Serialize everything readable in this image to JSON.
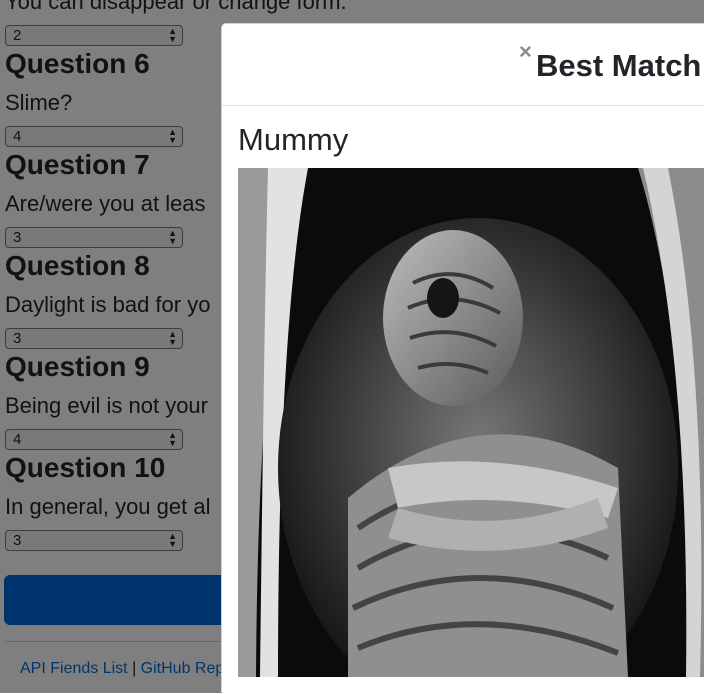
{
  "questions": {
    "q5": {
      "text": "You can disappear or change form.",
      "value": "2"
    },
    "q6": {
      "title": "Question 6",
      "text": "Slime?",
      "value": "4"
    },
    "q7": {
      "title": "Question 7",
      "text": "Are/were you at leas",
      "value": "3"
    },
    "q8": {
      "title": "Question 8",
      "text": "Daylight is bad for yo",
      "value": "3"
    },
    "q9": {
      "title": "Question 9",
      "text": "Being evil is not your",
      "value": "4"
    },
    "q10": {
      "title": "Question 10",
      "text": "In general, you get al",
      "value": "3"
    }
  },
  "footer": {
    "link1": "API Fiends List",
    "separator": "|",
    "link2": "GitHub Rep"
  },
  "modal": {
    "close_glyph": "×",
    "title": "Best Match",
    "match_name": "Mummy",
    "image_alt": "mummy-photo"
  },
  "colors": {
    "primary": "#0069d9",
    "overlay": "rgba(0,0,0,0.5)"
  }
}
